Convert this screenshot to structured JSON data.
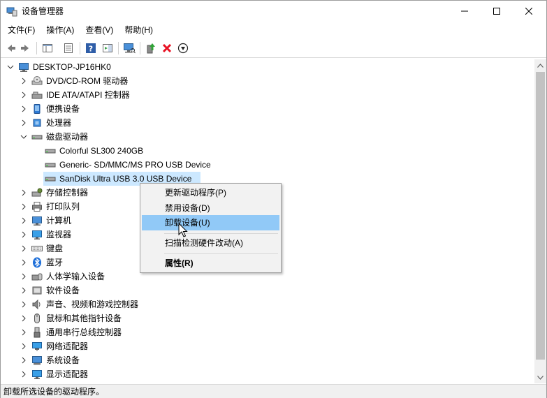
{
  "window": {
    "title": "设备管理器"
  },
  "menubar": [
    {
      "label": "文件(F)"
    },
    {
      "label": "操作(A)"
    },
    {
      "label": "查看(V)"
    },
    {
      "label": "帮助(H)"
    }
  ],
  "toolbar": {
    "buttons": [
      "back-icon",
      "forward-icon",
      "show-hide-tree-icon",
      "properties-icon",
      "help-icon",
      "action-pane-icon",
      "scan-hardware-icon",
      "update-driver-icon",
      "uninstall-icon",
      "disable-icon"
    ]
  },
  "tree": {
    "root": "DESKTOP-JP16HK0",
    "categories": [
      {
        "label": "DVD/CD-ROM 驱动器",
        "icon": "dvd-drive-icon"
      },
      {
        "label": "IDE ATA/ATAPI 控制器",
        "icon": "ide-controller-icon"
      },
      {
        "label": "便携设备",
        "icon": "portable-device-icon"
      },
      {
        "label": "处理器",
        "icon": "processor-icon"
      },
      {
        "label": "磁盘驱动器",
        "icon": "disk-drive-icon",
        "expanded": true,
        "children": [
          {
            "label": "Colorful SL300 240GB",
            "icon": "disk-drive-icon"
          },
          {
            "label": "Generic- SD/MMC/MS PRO USB Device",
            "icon": "disk-drive-icon"
          },
          {
            "label": "SanDisk Ultra USB 3.0 USB Device",
            "icon": "disk-drive-icon",
            "selected": true
          }
        ]
      },
      {
        "label": "存储控制器",
        "icon": "storage-controller-icon"
      },
      {
        "label": "打印队列",
        "icon": "printer-icon"
      },
      {
        "label": "计算机",
        "icon": "computer-icon"
      },
      {
        "label": "监视器",
        "icon": "monitor-icon"
      },
      {
        "label": "键盘",
        "icon": "keyboard-icon"
      },
      {
        "label": "蓝牙",
        "icon": "bluetooth-icon"
      },
      {
        "label": "人体学输入设备",
        "icon": "hid-icon"
      },
      {
        "label": "软件设备",
        "icon": "software-device-icon"
      },
      {
        "label": "声音、视频和游戏控制器",
        "icon": "sound-icon"
      },
      {
        "label": "鼠标和其他指针设备",
        "icon": "mouse-icon"
      },
      {
        "label": "通用串行总线控制器",
        "icon": "usb-icon"
      },
      {
        "label": "网络适配器",
        "icon": "network-adapter-icon"
      },
      {
        "label": "系统设备",
        "icon": "system-device-icon"
      },
      {
        "label": "显示适配器",
        "icon": "display-adapter-icon"
      }
    ]
  },
  "context_menu": {
    "items": [
      {
        "label": "更新驱动程序(P)"
      },
      {
        "label": "禁用设备(D)"
      },
      {
        "label": "卸载设备(U)",
        "hovered": true
      },
      {
        "label": "扫描检测硬件改动(A)"
      },
      {
        "label": "属性(R)",
        "bold": true
      }
    ]
  },
  "statusbar": {
    "text": "卸载所选设备的驱动程序。"
  },
  "colors": {
    "selection": "#cce8ff",
    "menu_hover": "#91c9f7",
    "accent_blue": "#1e6fd9",
    "uninstall_red": "#e81123"
  }
}
